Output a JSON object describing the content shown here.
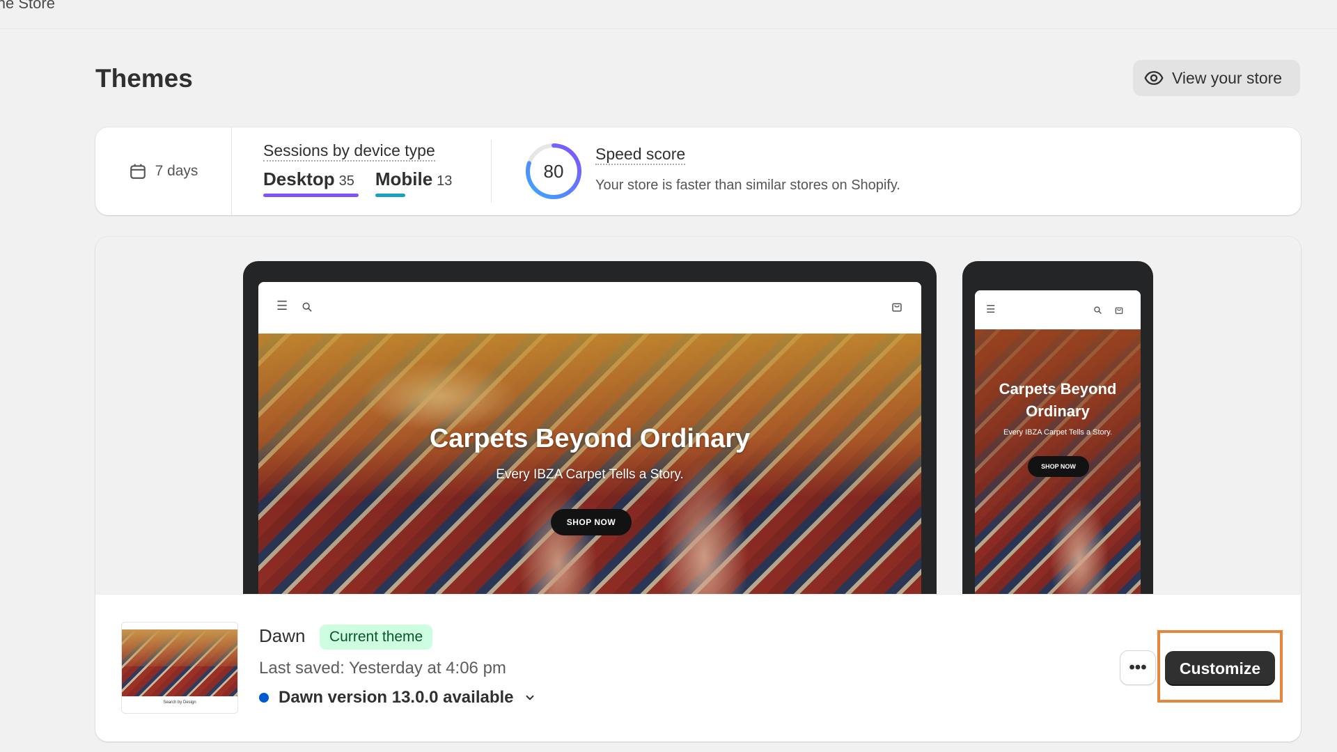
{
  "topbar": {
    "title": "line Store"
  },
  "page": {
    "title": "Themes",
    "view_store_label": "View your store"
  },
  "stats": {
    "date_range": "7 days",
    "sessions_label": "Sessions by device type",
    "devices": [
      {
        "name": "Desktop",
        "count": "35",
        "color": "#8051ff"
      },
      {
        "name": "Mobile",
        "count": "13",
        "color": "#1b9fc4"
      }
    ],
    "speed": {
      "score": "80",
      "title": "Speed score",
      "description": "Your store is faster than similar stores on Shopify."
    }
  },
  "preview": {
    "desktop": {
      "hero_title": "Carpets Beyond Ordinary",
      "hero_subtitle": "Every IBZA Carpet Tells a Story.",
      "cta": "SHOP NOW"
    },
    "mobile": {
      "hero_title": "Carpets Beyond Ordinary",
      "hero_subtitle": "Every IBZA Carpet Tells a Story.",
      "cta": "SHOP NOW"
    }
  },
  "theme": {
    "name": "Dawn",
    "badge": "Current theme",
    "last_saved": "Last saved: Yesterday at 4:06 pm",
    "version": "Dawn version 13.0.0 available",
    "thumbnail_caption": "Search by Design",
    "more_label": "•••",
    "customize_label": "Customize"
  },
  "colors": {
    "accent": "#303030",
    "badge_bg": "#cdfee1",
    "highlight": "#e8843b",
    "version_dot": "#005bd3"
  }
}
